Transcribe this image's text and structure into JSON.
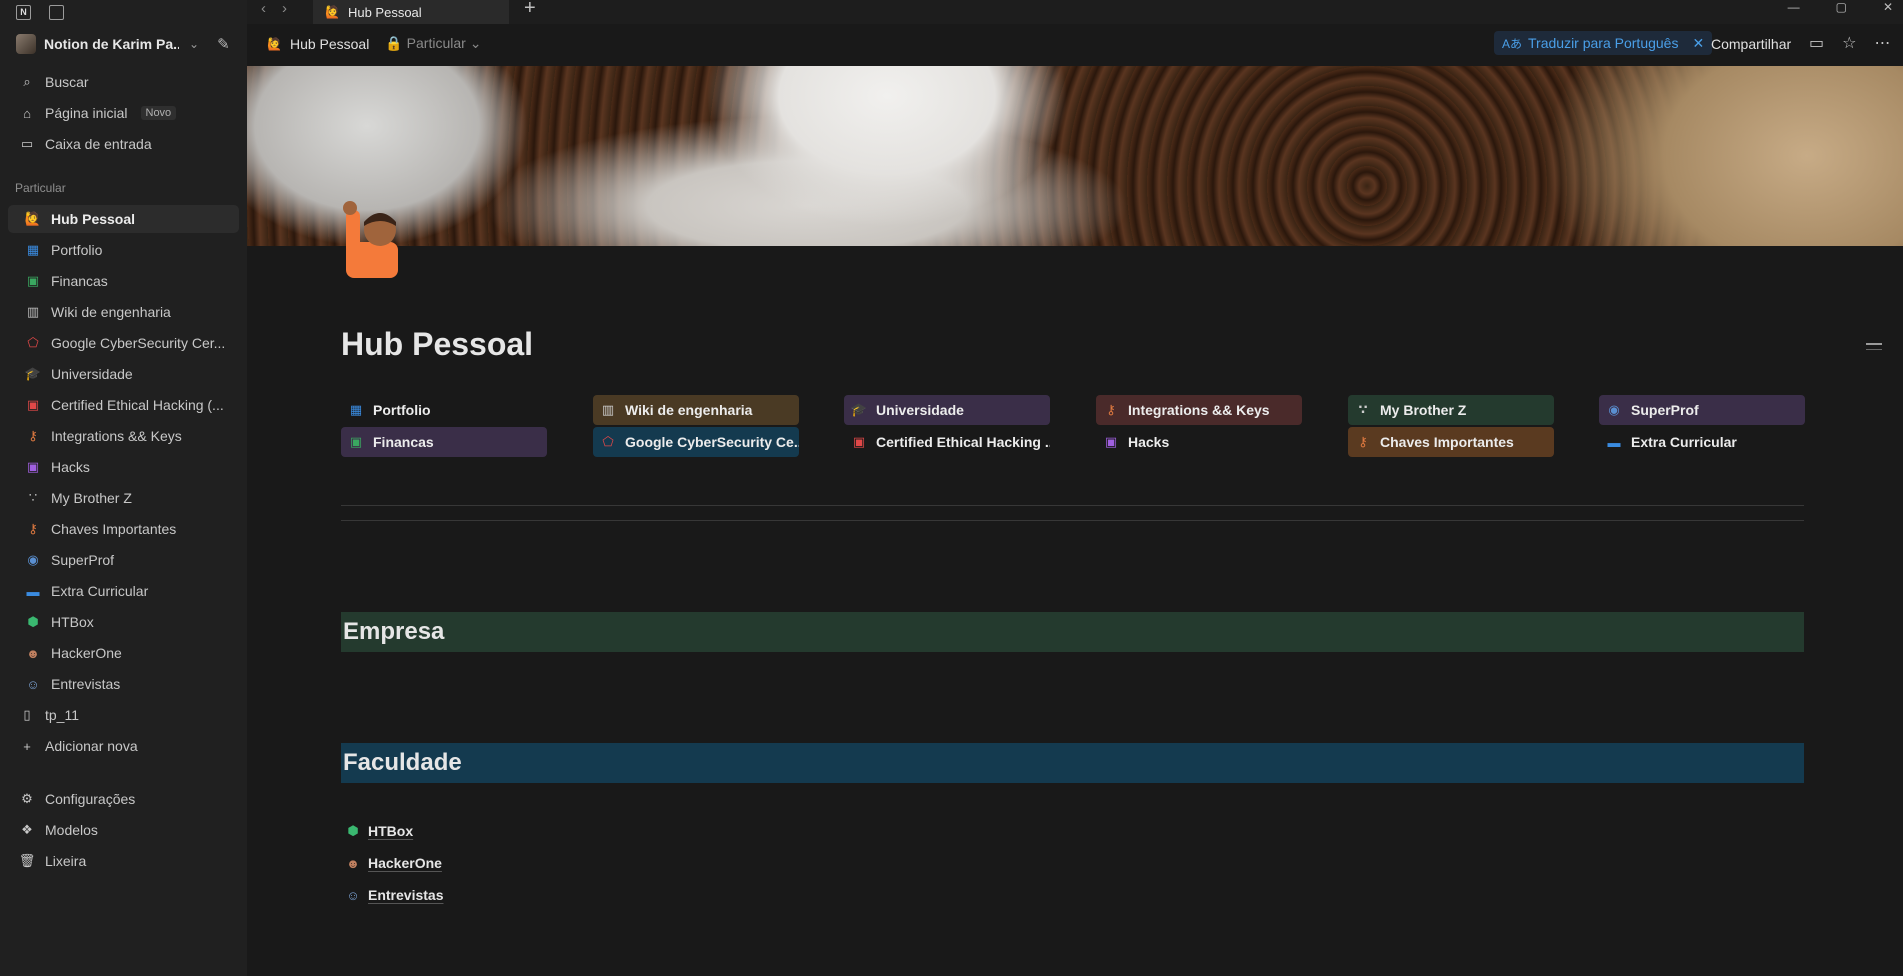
{
  "workspace": {
    "name": "Notion de Karim Pa..."
  },
  "sidebar": {
    "top": [
      {
        "label": "Buscar",
        "icon": "search-icon"
      },
      {
        "label": "Página inicial",
        "icon": "home-icon",
        "badge": "Novo"
      },
      {
        "label": "Caixa de entrada",
        "icon": "inbox-icon"
      }
    ],
    "section_label": "Particular",
    "pages": [
      {
        "label": "Hub Pessoal",
        "icon": "waving-person-icon",
        "active": true
      },
      {
        "label": "Portfolio",
        "icon": "portfolio-icon"
      },
      {
        "label": "Financas",
        "icon": "money-icon"
      },
      {
        "label": "Wiki de engenharia",
        "icon": "building-icon"
      },
      {
        "label": "Google CyberSecurity Cer...",
        "icon": "pentagon-icon"
      },
      {
        "label": "Universidade",
        "icon": "graduation-cap-icon"
      },
      {
        "label": "Certified Ethical Hacking (...",
        "icon": "terminal-icon"
      },
      {
        "label": "Integrations && Keys",
        "icon": "key-icon"
      },
      {
        "label": "Hacks",
        "icon": "terminal-icon"
      },
      {
        "label": "My Brother Z",
        "icon": "alien-icon"
      },
      {
        "label": "Chaves Importantes",
        "icon": "key-icon"
      },
      {
        "label": "SuperProf",
        "icon": "avatar-icon"
      },
      {
        "label": "Extra Curricular",
        "icon": "laptop-icon"
      },
      {
        "label": "HTBox",
        "icon": "cube-icon"
      },
      {
        "label": "HackerOne",
        "icon": "person-laptop-icon"
      },
      {
        "label": "Entrevistas",
        "icon": "interview-icon"
      }
    ],
    "extra": [
      {
        "label": "tp_11",
        "icon": "document-icon"
      },
      {
        "label": "Adicionar nova",
        "icon": "plus-icon"
      }
    ],
    "bottom": [
      {
        "label": "Configurações",
        "icon": "gear-icon"
      },
      {
        "label": "Modelos",
        "icon": "templates-icon"
      },
      {
        "label": "Lixeira",
        "icon": "trash-icon"
      }
    ]
  },
  "tab": {
    "title": "Hub Pessoal"
  },
  "header": {
    "breadcrumb": "Hub Pessoal",
    "privacy": "Particular",
    "translate": "Traduzir para Português",
    "share": "Compartilhar"
  },
  "page": {
    "title": "Hub Pessoal",
    "links_row1": [
      "Portfolio",
      "Wiki de engenharia",
      "Universidade",
      "Integrations && Keys",
      "My Brother Z",
      "SuperProf"
    ],
    "links_row2": [
      "Financas",
      "Google CyberSecurity Ce...",
      "Certified Ethical Hacking ...",
      "Hacks",
      "Chaves Importantes",
      "Extra Curricular"
    ],
    "section1": "Empresa",
    "section2": "Faculdade",
    "faculdade_links": [
      "HTBox",
      "HackerOne",
      "Entrevistas"
    ]
  },
  "colors": {
    "accent_blue": "#4a9fe8",
    "band_empresa": "#243a2e",
    "band_faculdade": "#143a4f"
  }
}
